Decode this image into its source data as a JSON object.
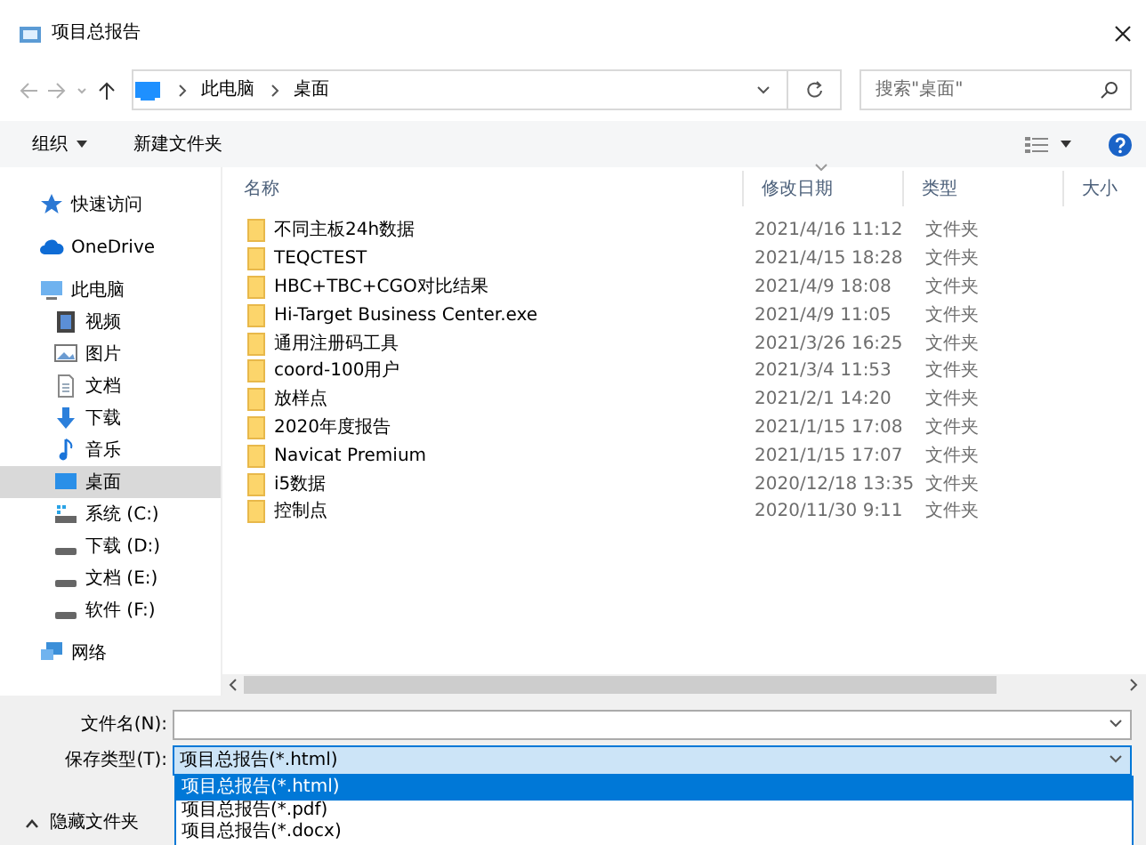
{
  "window": {
    "title": "项目总报告"
  },
  "address": {
    "path": [
      "此电脑",
      "桌面"
    ]
  },
  "search": {
    "placeholder": "搜索\"桌面\""
  },
  "toolbar": {
    "organize": "组织",
    "new_folder": "新建文件夹"
  },
  "sidebar": {
    "items": [
      {
        "label": "快速访问",
        "kind": "quick-access",
        "selected": false
      },
      {
        "label": "OneDrive",
        "kind": "cloud",
        "selected": false
      },
      {
        "label": "此电脑",
        "kind": "computer",
        "selected": false,
        "children": [
          {
            "label": "视频",
            "kind": "video",
            "selected": false
          },
          {
            "label": "图片",
            "kind": "pictures",
            "selected": false
          },
          {
            "label": "文档",
            "kind": "documents",
            "selected": false
          },
          {
            "label": "下载",
            "kind": "downloads",
            "selected": false
          },
          {
            "label": "音乐",
            "kind": "music",
            "selected": false
          },
          {
            "label": "桌面",
            "kind": "desktop",
            "selected": true
          },
          {
            "label": "系统 (C:)",
            "kind": "system-drive",
            "selected": false
          },
          {
            "label": "下载 (D:)",
            "kind": "drive",
            "selected": false
          },
          {
            "label": "文档 (E:)",
            "kind": "drive",
            "selected": false
          },
          {
            "label": "软件 (F:)",
            "kind": "drive",
            "selected": false
          }
        ]
      },
      {
        "label": "网络",
        "kind": "network",
        "selected": false
      }
    ]
  },
  "table": {
    "columns": [
      "名称",
      "修改日期",
      "类型",
      "大小"
    ],
    "rows": [
      {
        "name": "不同主板24h数据",
        "modified": "2021/4/16 11:12",
        "type": "文件夹"
      },
      {
        "name": "TEQCTEST",
        "modified": "2021/4/15 18:28",
        "type": "文件夹"
      },
      {
        "name": "HBC+TBC+CGO对比结果",
        "modified": "2021/4/9 18:08",
        "type": "文件夹"
      },
      {
        "name": "Hi-Target Business Center.exe",
        "modified": "2021/4/9 11:05",
        "type": "文件夹"
      },
      {
        "name": "通用注册码工具",
        "modified": "2021/3/26 16:25",
        "type": "文件夹"
      },
      {
        "name": "coord-100用户",
        "modified": "2021/3/4 11:53",
        "type": "文件夹"
      },
      {
        "name": "放样点",
        "modified": "2021/2/1 14:20",
        "type": "文件夹"
      },
      {
        "name": "2020年度报告",
        "modified": "2021/1/15 17:08",
        "type": "文件夹"
      },
      {
        "name": "Navicat Premium",
        "modified": "2021/1/15 17:07",
        "type": "文件夹"
      },
      {
        "name": "i5数据",
        "modified": "2020/12/18 13:35",
        "type": "文件夹"
      },
      {
        "name": "控制点",
        "modified": "2020/11/30 9:11",
        "type": "文件夹"
      }
    ]
  },
  "form": {
    "file_name_label": "文件名(N):",
    "save_type_label": "保存类型(T):",
    "save_type_value": "项目总报告(*.html)",
    "save_type_options": [
      {
        "label": "项目总报告(*.html)",
        "selected": true
      },
      {
        "label": "项目总报告(*.pdf)",
        "selected": false
      },
      {
        "label": "项目总报告(*.docx)",
        "selected": false
      }
    ]
  },
  "hide_folders": "隐藏文件夹"
}
